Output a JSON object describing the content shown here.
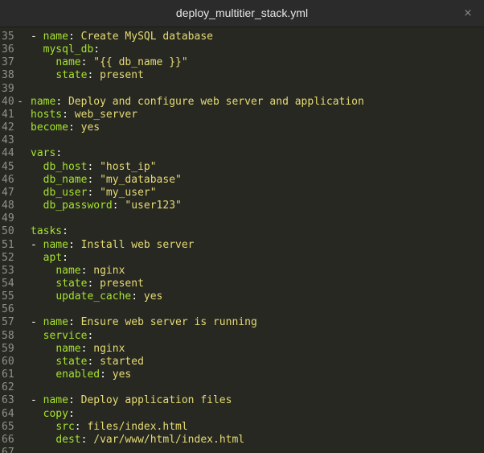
{
  "window": {
    "title": "deploy_multitier_stack.yml",
    "close_glyph": "×"
  },
  "colors": {
    "background": "#272822",
    "key": "#a6e22e",
    "value": "#e6db74",
    "punctuation": "#f8f8f2",
    "gutter": "#90908a"
  },
  "lines": [
    {
      "num": "35",
      "fold": "",
      "tokens": [
        {
          "t": "p",
          "s": "- "
        },
        {
          "t": "k",
          "s": "name"
        },
        {
          "t": "p",
          "s": ": "
        },
        {
          "t": "v",
          "s": "Create MySQL database"
        }
      ]
    },
    {
      "num": "36",
      "fold": "",
      "tokens": [
        {
          "t": "p",
          "s": "  "
        },
        {
          "t": "k",
          "s": "mysql_db"
        },
        {
          "t": "p",
          "s": ":"
        }
      ]
    },
    {
      "num": "37",
      "fold": "",
      "tokens": [
        {
          "t": "p",
          "s": "    "
        },
        {
          "t": "k",
          "s": "name"
        },
        {
          "t": "p",
          "s": ": "
        },
        {
          "t": "v",
          "s": "\"{{ db_name }}\""
        }
      ]
    },
    {
      "num": "38",
      "fold": "",
      "tokens": [
        {
          "t": "p",
          "s": "    "
        },
        {
          "t": "k",
          "s": "state"
        },
        {
          "t": "p",
          "s": ": "
        },
        {
          "t": "v",
          "s": "present"
        }
      ]
    },
    {
      "num": "39",
      "fold": "",
      "tokens": []
    },
    {
      "num": "40",
      "fold": "-",
      "tokens": [
        {
          "t": "k",
          "s": "name"
        },
        {
          "t": "p",
          "s": ": "
        },
        {
          "t": "v",
          "s": "Deploy and configure web server and application"
        }
      ]
    },
    {
      "num": "41",
      "fold": "",
      "tokens": [
        {
          "t": "k",
          "s": "hosts"
        },
        {
          "t": "p",
          "s": ": "
        },
        {
          "t": "v",
          "s": "web_server"
        }
      ]
    },
    {
      "num": "42",
      "fold": "",
      "tokens": [
        {
          "t": "k",
          "s": "become"
        },
        {
          "t": "p",
          "s": ": "
        },
        {
          "t": "v",
          "s": "yes"
        }
      ]
    },
    {
      "num": "43",
      "fold": "",
      "tokens": []
    },
    {
      "num": "44",
      "fold": "",
      "tokens": [
        {
          "t": "k",
          "s": "vars"
        },
        {
          "t": "p",
          "s": ":"
        }
      ]
    },
    {
      "num": "45",
      "fold": "",
      "tokens": [
        {
          "t": "p",
          "s": "  "
        },
        {
          "t": "k",
          "s": "db_host"
        },
        {
          "t": "p",
          "s": ": "
        },
        {
          "t": "v",
          "s": "\"host_ip\""
        }
      ]
    },
    {
      "num": "46",
      "fold": "",
      "tokens": [
        {
          "t": "p",
          "s": "  "
        },
        {
          "t": "k",
          "s": "db_name"
        },
        {
          "t": "p",
          "s": ": "
        },
        {
          "t": "v",
          "s": "\"my_database\""
        }
      ]
    },
    {
      "num": "47",
      "fold": "",
      "tokens": [
        {
          "t": "p",
          "s": "  "
        },
        {
          "t": "k",
          "s": "db_user"
        },
        {
          "t": "p",
          "s": ": "
        },
        {
          "t": "v",
          "s": "\"my_user\""
        }
      ]
    },
    {
      "num": "48",
      "fold": "",
      "tokens": [
        {
          "t": "p",
          "s": "  "
        },
        {
          "t": "k",
          "s": "db_password"
        },
        {
          "t": "p",
          "s": ": "
        },
        {
          "t": "v",
          "s": "\"user123\""
        }
      ]
    },
    {
      "num": "49",
      "fold": "",
      "tokens": []
    },
    {
      "num": "50",
      "fold": "",
      "tokens": [
        {
          "t": "k",
          "s": "tasks"
        },
        {
          "t": "p",
          "s": ":"
        }
      ]
    },
    {
      "num": "51",
      "fold": "",
      "tokens": [
        {
          "t": "p",
          "s": "- "
        },
        {
          "t": "k",
          "s": "name"
        },
        {
          "t": "p",
          "s": ": "
        },
        {
          "t": "v",
          "s": "Install web server"
        }
      ]
    },
    {
      "num": "52",
      "fold": "",
      "tokens": [
        {
          "t": "p",
          "s": "  "
        },
        {
          "t": "k",
          "s": "apt"
        },
        {
          "t": "p",
          "s": ":"
        }
      ]
    },
    {
      "num": "53",
      "fold": "",
      "tokens": [
        {
          "t": "p",
          "s": "    "
        },
        {
          "t": "k",
          "s": "name"
        },
        {
          "t": "p",
          "s": ": "
        },
        {
          "t": "v",
          "s": "nginx"
        }
      ]
    },
    {
      "num": "54",
      "fold": "",
      "tokens": [
        {
          "t": "p",
          "s": "    "
        },
        {
          "t": "k",
          "s": "state"
        },
        {
          "t": "p",
          "s": ": "
        },
        {
          "t": "v",
          "s": "present"
        }
      ]
    },
    {
      "num": "55",
      "fold": "",
      "tokens": [
        {
          "t": "p",
          "s": "    "
        },
        {
          "t": "k",
          "s": "update_cache"
        },
        {
          "t": "p",
          "s": ": "
        },
        {
          "t": "v",
          "s": "yes"
        }
      ]
    },
    {
      "num": "56",
      "fold": "",
      "tokens": []
    },
    {
      "num": "57",
      "fold": "",
      "tokens": [
        {
          "t": "p",
          "s": "- "
        },
        {
          "t": "k",
          "s": "name"
        },
        {
          "t": "p",
          "s": ": "
        },
        {
          "t": "v",
          "s": "Ensure web server is running"
        }
      ]
    },
    {
      "num": "58",
      "fold": "",
      "tokens": [
        {
          "t": "p",
          "s": "  "
        },
        {
          "t": "k",
          "s": "service"
        },
        {
          "t": "p",
          "s": ":"
        }
      ]
    },
    {
      "num": "59",
      "fold": "",
      "tokens": [
        {
          "t": "p",
          "s": "    "
        },
        {
          "t": "k",
          "s": "name"
        },
        {
          "t": "p",
          "s": ": "
        },
        {
          "t": "v",
          "s": "nginx"
        }
      ]
    },
    {
      "num": "60",
      "fold": "",
      "tokens": [
        {
          "t": "p",
          "s": "    "
        },
        {
          "t": "k",
          "s": "state"
        },
        {
          "t": "p",
          "s": ": "
        },
        {
          "t": "v",
          "s": "started"
        }
      ]
    },
    {
      "num": "61",
      "fold": "",
      "tokens": [
        {
          "t": "p",
          "s": "    "
        },
        {
          "t": "k",
          "s": "enabled"
        },
        {
          "t": "p",
          "s": ": "
        },
        {
          "t": "v",
          "s": "yes"
        }
      ]
    },
    {
      "num": "62",
      "fold": "",
      "tokens": []
    },
    {
      "num": "63",
      "fold": "",
      "tokens": [
        {
          "t": "p",
          "s": "- "
        },
        {
          "t": "k",
          "s": "name"
        },
        {
          "t": "p",
          "s": ": "
        },
        {
          "t": "v",
          "s": "Deploy application files"
        }
      ]
    },
    {
      "num": "64",
      "fold": "",
      "tokens": [
        {
          "t": "p",
          "s": "  "
        },
        {
          "t": "k",
          "s": "copy"
        },
        {
          "t": "p",
          "s": ":"
        }
      ]
    },
    {
      "num": "65",
      "fold": "",
      "tokens": [
        {
          "t": "p",
          "s": "    "
        },
        {
          "t": "k",
          "s": "src"
        },
        {
          "t": "p",
          "s": ": "
        },
        {
          "t": "v",
          "s": "files/index.html"
        }
      ]
    },
    {
      "num": "66",
      "fold": "",
      "tokens": [
        {
          "t": "p",
          "s": "    "
        },
        {
          "t": "k",
          "s": "dest"
        },
        {
          "t": "p",
          "s": ": "
        },
        {
          "t": "v",
          "s": "/var/www/html/index.html"
        }
      ]
    },
    {
      "num": "67",
      "fold": "",
      "tokens": []
    }
  ]
}
